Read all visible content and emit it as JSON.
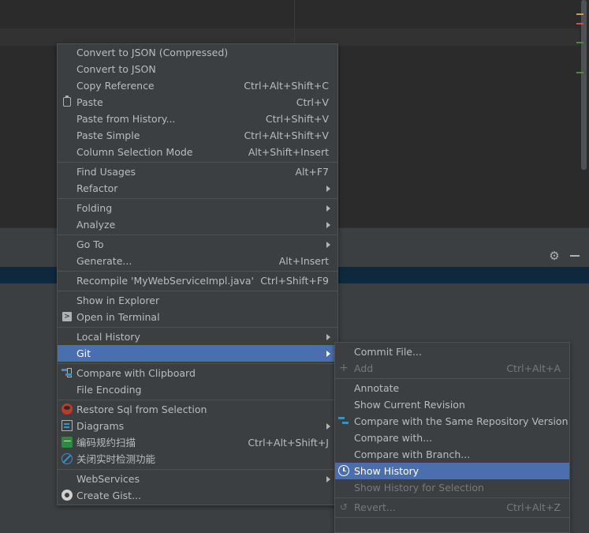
{
  "main_menu": {
    "convert_compressed": "Convert to JSON (Compressed)",
    "convert_json": "Convert to JSON",
    "copy_reference": {
      "label": "Copy Reference",
      "shortcut": "Ctrl+Alt+Shift+C"
    },
    "paste": {
      "label": "Paste",
      "shortcut": "Ctrl+V"
    },
    "paste_history": {
      "label": "Paste from History...",
      "shortcut": "Ctrl+Shift+V"
    },
    "paste_simple": {
      "label": "Paste Simple",
      "shortcut": "Ctrl+Alt+Shift+V"
    },
    "column_selection": {
      "label": "Column Selection Mode",
      "shortcut": "Alt+Shift+Insert"
    },
    "find_usages": {
      "label": "Find Usages",
      "shortcut": "Alt+F7"
    },
    "refactor": "Refactor",
    "folding": "Folding",
    "analyze": "Analyze",
    "go_to": "Go To",
    "generate": {
      "label": "Generate...",
      "shortcut": "Alt+Insert"
    },
    "recompile": {
      "label": "Recompile 'MyWebServiceImpl.java'",
      "shortcut": "Ctrl+Shift+F9"
    },
    "show_explorer": "Show in Explorer",
    "open_terminal": "Open in Terminal",
    "local_history": "Local History",
    "git": "Git",
    "compare_clipboard": "Compare with Clipboard",
    "file_encoding": "File Encoding",
    "restore_sql": "Restore Sql from Selection",
    "diagrams": "Diagrams",
    "code_scan": {
      "label": "编码规约扫描",
      "shortcut": "Ctrl+Alt+Shift+J"
    },
    "realtime_detect": "关闭实时检测功能",
    "webservices": "WebServices",
    "create_gist": "Create Gist..."
  },
  "git_submenu": {
    "commit_file": "Commit File...",
    "add": {
      "label": "Add",
      "shortcut": "Ctrl+Alt+A"
    },
    "annotate": "Annotate",
    "show_current_revision": "Show Current Revision",
    "compare_same_repo": "Compare with the Same Repository Version",
    "compare_with": "Compare with...",
    "compare_branch": "Compare with Branch...",
    "show_history": "Show History",
    "show_history_selection": "Show History for Selection",
    "revert": {
      "label": "Revert...",
      "shortcut": "Ctrl+Alt+Z"
    }
  },
  "icons": {
    "gear": "gear-icon",
    "minimize": "minimize-icon"
  },
  "colors": {
    "selection": "#4b6eaf",
    "menu_bg": "#3c3f41",
    "editor_bg": "#2b2b2b",
    "tool_selection": "#0d293e"
  }
}
